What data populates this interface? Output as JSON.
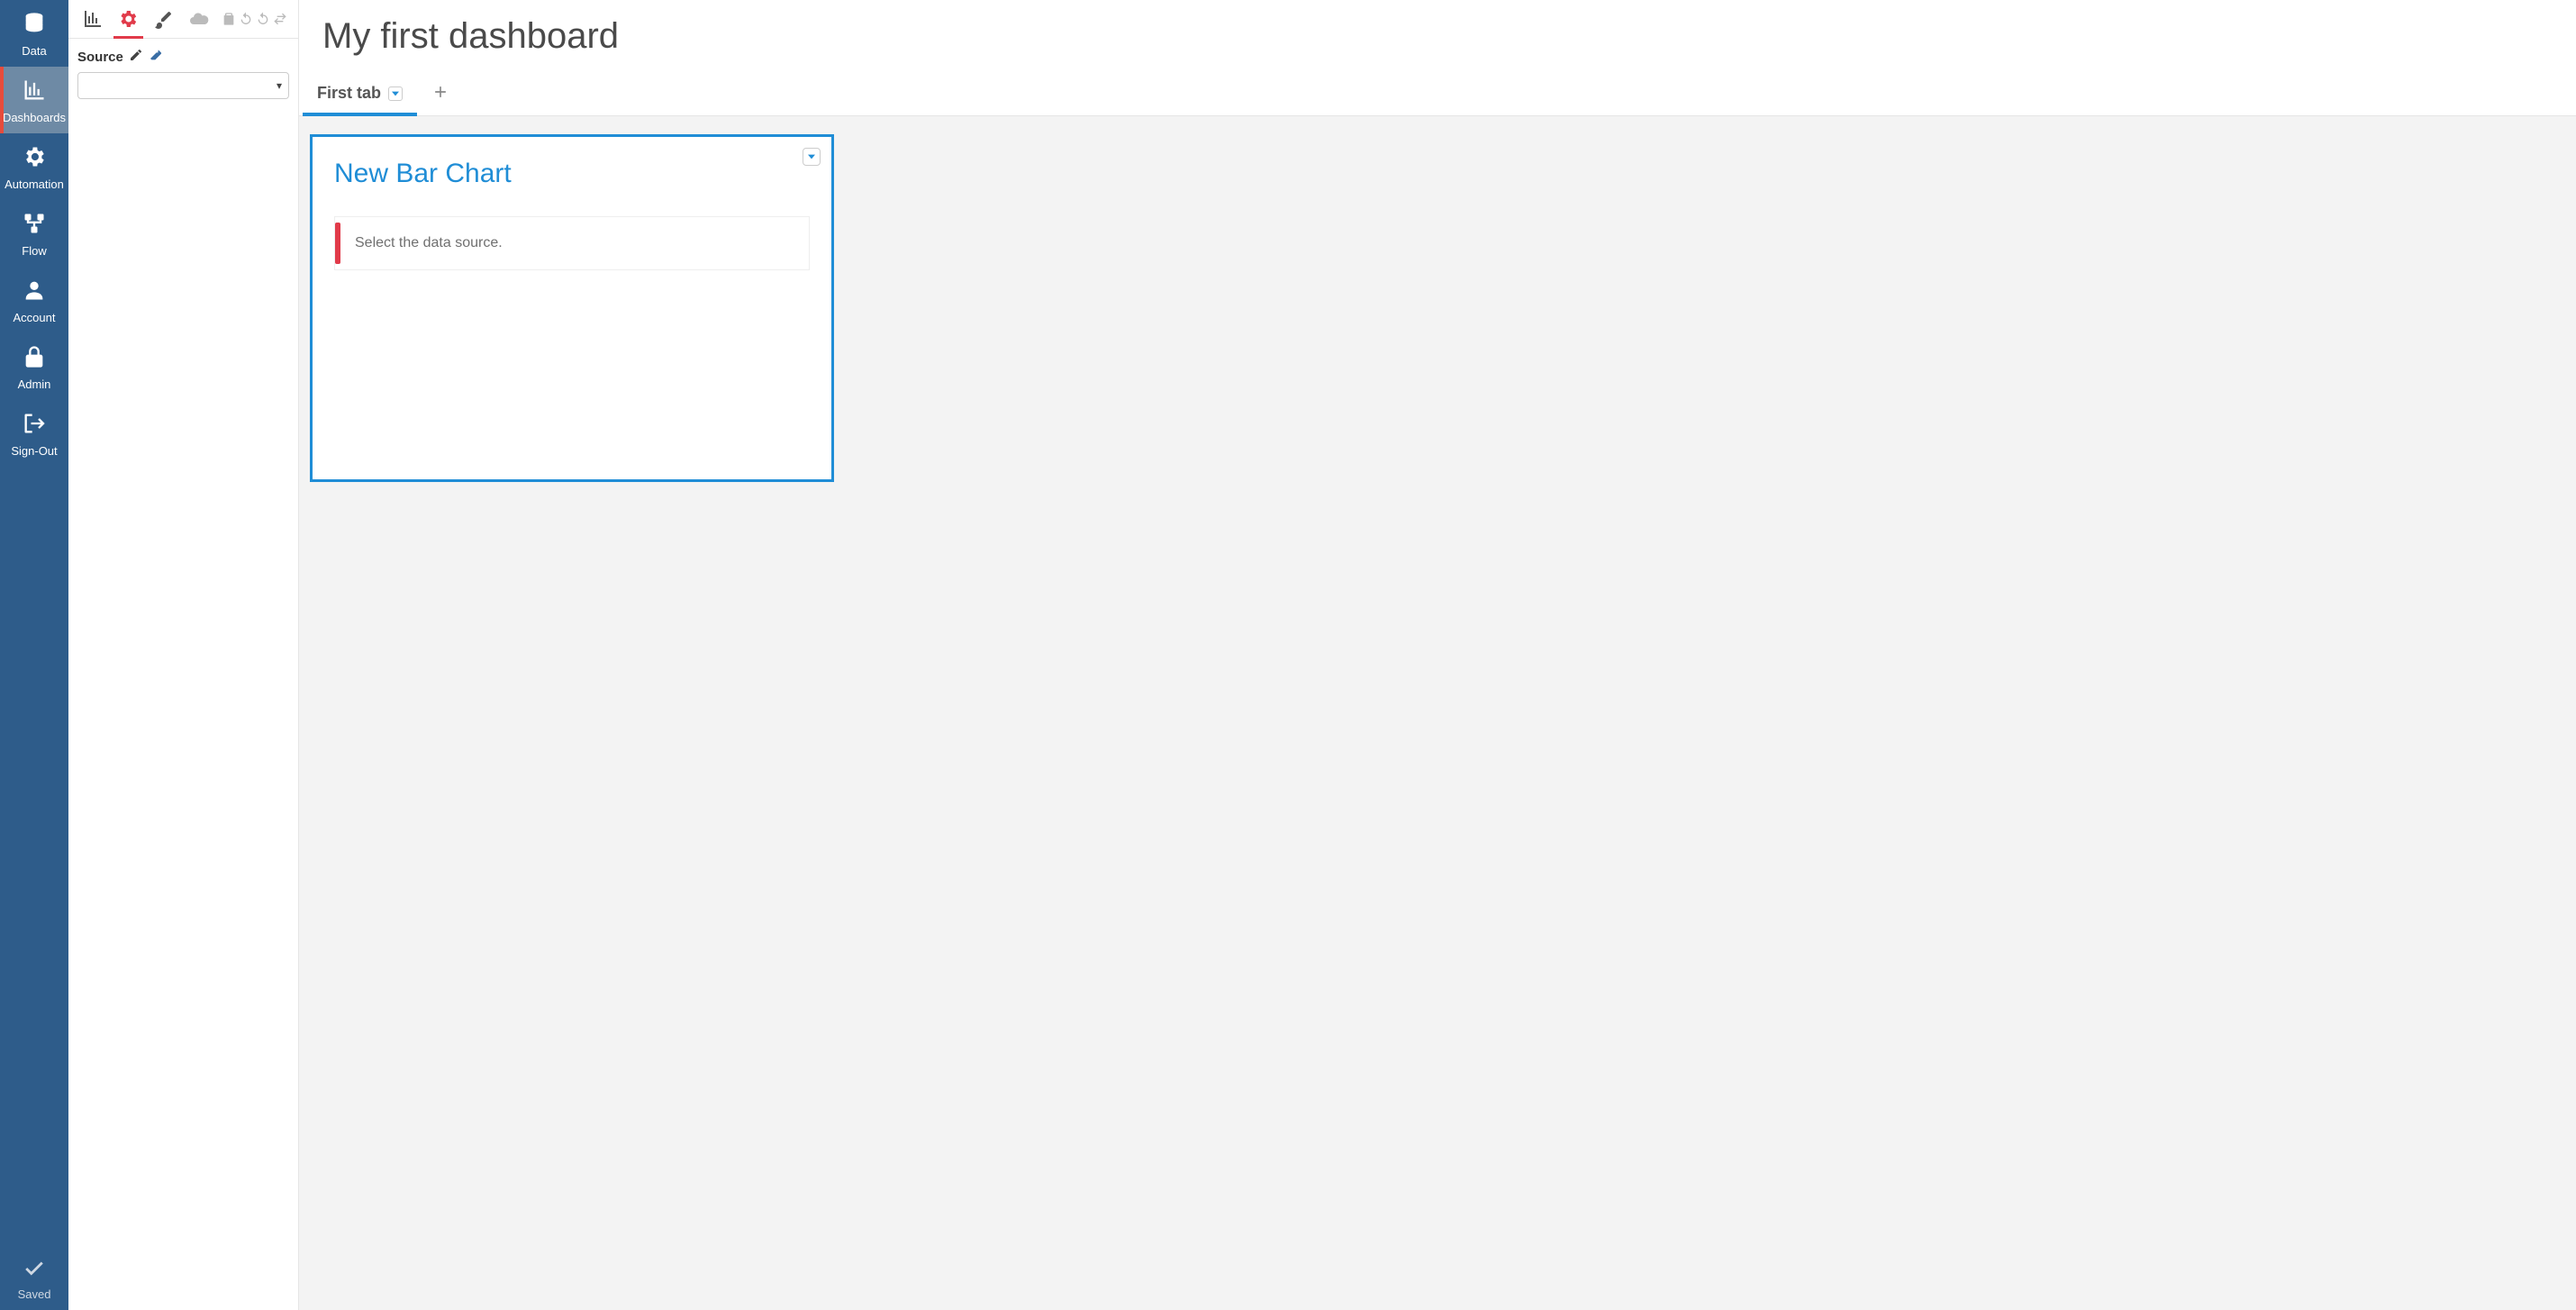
{
  "leftnav": {
    "items": [
      {
        "id": "data",
        "label": "Data",
        "icon": "database-icon"
      },
      {
        "id": "dashboards",
        "label": "Dashboards",
        "icon": "bar-chart-icon"
      },
      {
        "id": "automation",
        "label": "Automation",
        "icon": "gears-icon"
      },
      {
        "id": "flow",
        "label": "Flow",
        "icon": "flow-icon"
      },
      {
        "id": "account",
        "label": "Account",
        "icon": "user-icon"
      },
      {
        "id": "admin",
        "label": "Admin",
        "icon": "lock-icon"
      },
      {
        "id": "signout",
        "label": "Sign-Out",
        "icon": "sign-out-icon"
      }
    ],
    "active": "dashboards",
    "saved_label": "Saved"
  },
  "toolbar": {
    "items": [
      {
        "id": "chart-type",
        "icon": "bar-chart-icon"
      },
      {
        "id": "settings",
        "icon": "gear-icon"
      },
      {
        "id": "style",
        "icon": "brush-icon"
      },
      {
        "id": "cloud",
        "icon": "cloud-icon"
      }
    ],
    "active": "settings",
    "history": [
      {
        "id": "clipboard",
        "icon": "clipboard-icon"
      },
      {
        "id": "undo",
        "icon": "undo-icon"
      },
      {
        "id": "redo",
        "icon": "redo-icon"
      },
      {
        "id": "swap",
        "icon": "swap-icon"
      }
    ]
  },
  "source_panel": {
    "label": "Source",
    "value": ""
  },
  "header": {
    "title": "My first dashboard"
  },
  "tabs": [
    {
      "label": "First tab",
      "active": true
    }
  ],
  "widget": {
    "title": "New Bar Chart",
    "notice": "Select the data source."
  },
  "colors": {
    "brand_blue": "#1f8dd6",
    "nav_blue": "#2e5c8a",
    "accent_red": "#e13b4a"
  }
}
